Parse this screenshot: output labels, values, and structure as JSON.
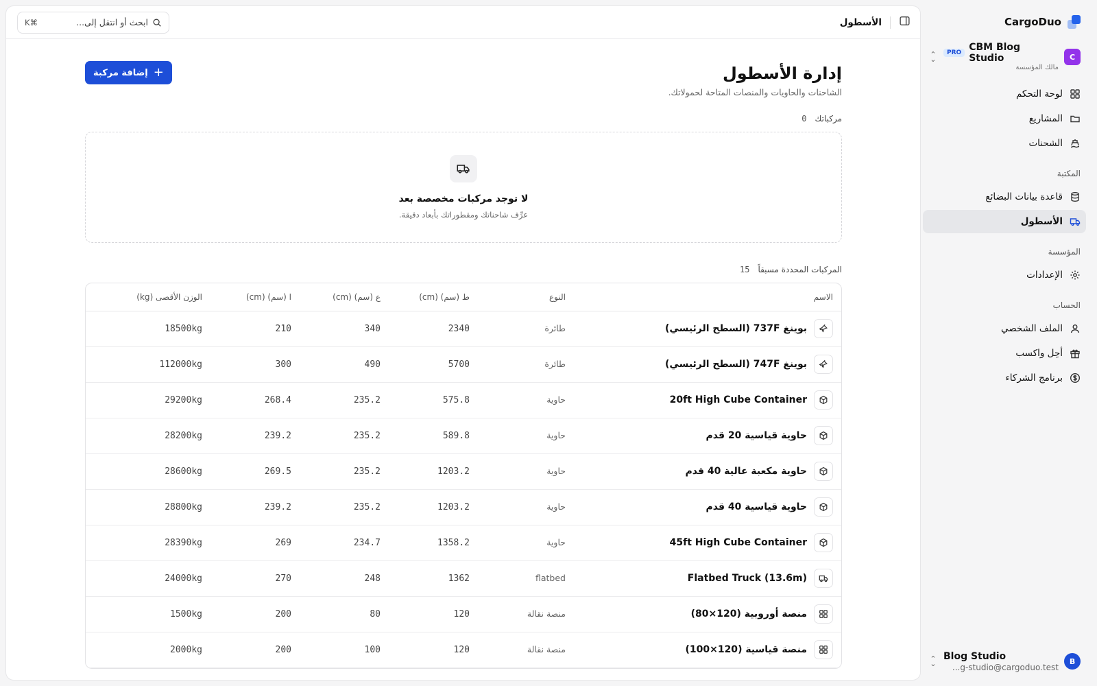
{
  "brand": {
    "name": "CargoDuo"
  },
  "org": {
    "avatar": "C",
    "name": "CBM Blog Studio",
    "badge": "PRO",
    "role": "مالك المؤسسة"
  },
  "nav": {
    "main": [
      {
        "label": "لوحة التحكم",
        "icon": "grid-icon"
      },
      {
        "label": "المشاريع",
        "icon": "folder-icon"
      },
      {
        "label": "الشحنات",
        "icon": "ship-icon"
      }
    ],
    "library_title": "المكتبة",
    "library": [
      {
        "label": "قاعدة بيانات البضائع",
        "icon": "database-icon"
      },
      {
        "label": "الأسطول",
        "icon": "truck-icon",
        "active": true
      }
    ],
    "org_title": "المؤسسة",
    "org_items": [
      {
        "label": "الإعدادات",
        "icon": "gear-icon"
      }
    ],
    "account_title": "الحساب",
    "account": [
      {
        "label": "الملف الشخصي",
        "icon": "user-icon"
      },
      {
        "label": "أحِل واكسب",
        "icon": "gift-icon"
      },
      {
        "label": "برنامج الشركاء",
        "icon": "dollar-icon"
      }
    ]
  },
  "user": {
    "avatar": "B",
    "name": "Blog Studio",
    "email": "...g-studio@cargoduo.test"
  },
  "topbar": {
    "title": "الأسطول",
    "search_placeholder": "ابحث أو انتقل إلى...",
    "shortcut": "K⌘"
  },
  "page": {
    "title": "إدارة الأسطول",
    "subtitle": "الشاحنات والحاويات والمنصات المتاحة لحمولاتك.",
    "add_button": "إضافة مركبة",
    "my_vehicles_label": "مركباتك",
    "my_vehicles_count": "0",
    "empty_title": "لا توجد مركبات مخصصة بعد",
    "empty_sub": "عرِّف شاحناتك ومقطوراتك بأبعاد دقيقة.",
    "predefined_label": "المركبات المحددة مسبقاً",
    "predefined_count": "15"
  },
  "table": {
    "headers": {
      "name": "الاسم",
      "type": "النوع",
      "length": "ط (سم) (cm)",
      "width": "ع (سم) (cm)",
      "height": "ا (سم) (cm)",
      "weight": "الوزن الأقصى (kg)"
    },
    "rows": [
      {
        "icon": "plane-icon",
        "name": "بوينغ 737F (السطح الرئيسي)",
        "type": "طائرة",
        "l": "2340",
        "w": "340",
        "h": "210",
        "kg": "18500kg"
      },
      {
        "icon": "plane-icon",
        "name": "بوينغ 747F (السطح الرئيسي)",
        "type": "طائرة",
        "l": "5700",
        "w": "490",
        "h": "300",
        "kg": "112000kg"
      },
      {
        "icon": "box-icon",
        "name": "20ft High Cube Container",
        "type": "حاوية",
        "l": "575.8",
        "w": "235.2",
        "h": "268.4",
        "kg": "29200kg"
      },
      {
        "icon": "box-icon",
        "name": "حاوية قياسية 20 قدم",
        "type": "حاوية",
        "l": "589.8",
        "w": "235.2",
        "h": "239.2",
        "kg": "28200kg"
      },
      {
        "icon": "box-icon",
        "name": "حاوية مكعبة عالية 40 قدم",
        "type": "حاوية",
        "l": "1203.2",
        "w": "235.2",
        "h": "269.5",
        "kg": "28600kg"
      },
      {
        "icon": "box-icon",
        "name": "حاوية قياسية 40 قدم",
        "type": "حاوية",
        "l": "1203.2",
        "w": "235.2",
        "h": "239.2",
        "kg": "28800kg"
      },
      {
        "icon": "box-icon",
        "name": "45ft High Cube Container",
        "type": "حاوية",
        "l": "1358.2",
        "w": "234.7",
        "h": "269",
        "kg": "28390kg"
      },
      {
        "icon": "truck-icon",
        "name": "Flatbed Truck (13.6m)",
        "type": "flatbed",
        "l": "1362",
        "w": "248",
        "h": "270",
        "kg": "24000kg"
      },
      {
        "icon": "pallet-icon",
        "name": "منصة أوروبية (120×80)",
        "type": "منصة نقالة",
        "l": "120",
        "w": "80",
        "h": "200",
        "kg": "1500kg"
      },
      {
        "icon": "pallet-icon",
        "name": "منصة قياسية (120×100)",
        "type": "منصة نقالة",
        "l": "120",
        "w": "100",
        "h": "200",
        "kg": "2000kg"
      }
    ]
  },
  "colors": {
    "accent": "#1d4ed8",
    "org_avatar": "#9333ea",
    "active_nav": "#e6e7ea"
  }
}
